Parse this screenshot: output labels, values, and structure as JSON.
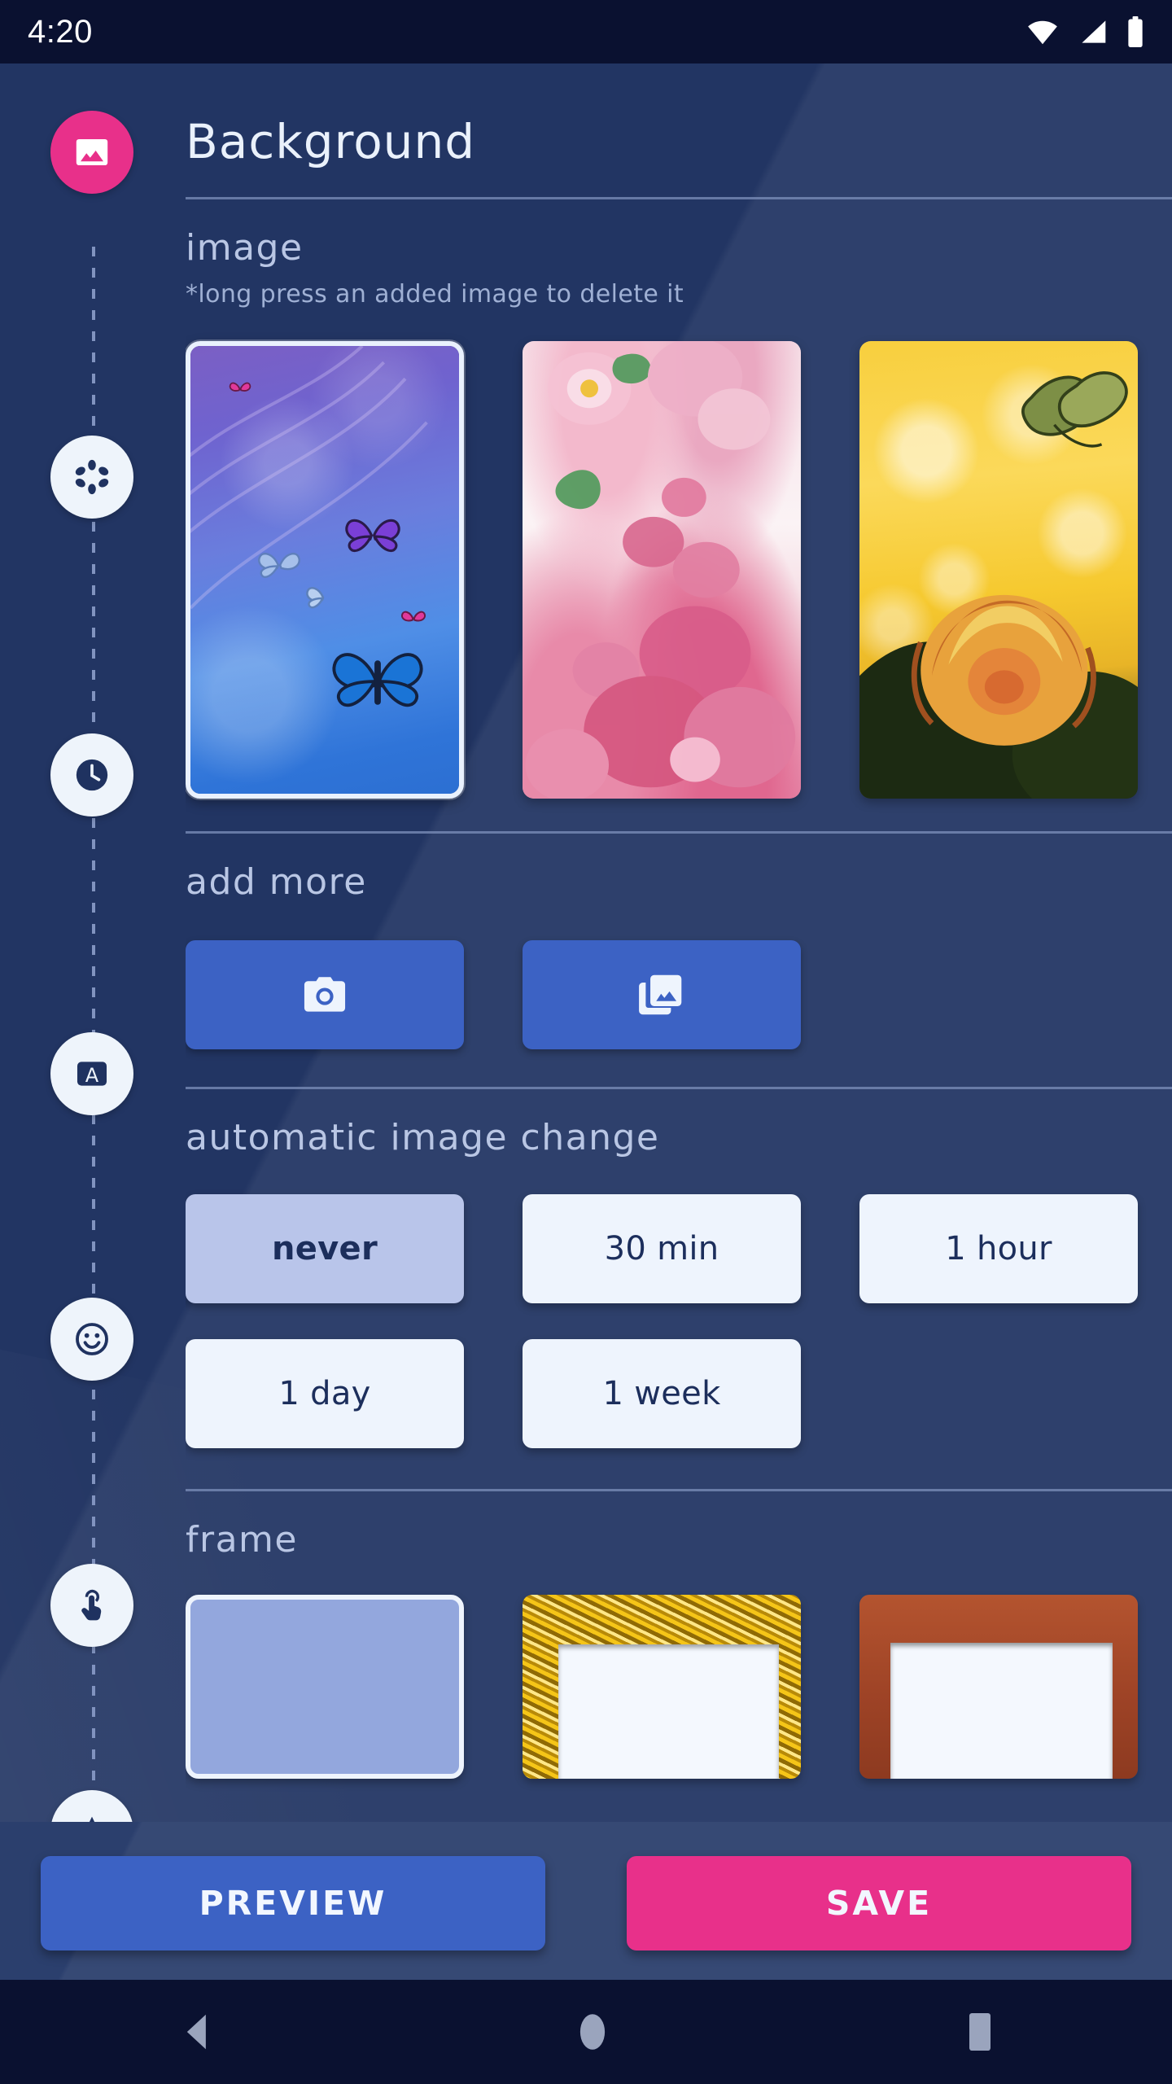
{
  "status_bar": {
    "time": "4:20",
    "icons": [
      "wifi-icon",
      "cellular-signal-icon",
      "battery-icon"
    ]
  },
  "header": {
    "title": "Background",
    "icon": "image-icon",
    "accent_color": "#e8308a"
  },
  "rail": {
    "items": [
      {
        "name": "background-image",
        "icon": "image-icon",
        "active": true
      },
      {
        "name": "style",
        "icon": "flower-icon",
        "active": false
      },
      {
        "name": "clock",
        "icon": "clock-icon",
        "active": false
      },
      {
        "name": "font",
        "icon": "font-a-icon",
        "active": false
      },
      {
        "name": "emoji",
        "icon": "smiley-icon",
        "active": false
      },
      {
        "name": "touch",
        "icon": "touch-pointer-icon",
        "active": false
      },
      {
        "name": "favorites",
        "icon": "star-icon",
        "active": false
      }
    ]
  },
  "sections": {
    "image": {
      "title": "image",
      "note": "*long press an added image to delete it",
      "thumbnails": [
        {
          "name": "butterfly-wallpaper",
          "selected": true
        },
        {
          "name": "pink-flowers-wallpaper",
          "selected": false
        },
        {
          "name": "yellow-rose-wallpaper",
          "selected": false
        }
      ]
    },
    "add_more": {
      "title": "add more",
      "buttons": [
        {
          "name": "camera-button",
          "icon": "camera-icon"
        },
        {
          "name": "gallery-button",
          "icon": "gallery-icon"
        }
      ]
    },
    "automatic_image_change": {
      "title": "automatic image change",
      "options": [
        {
          "label": "never",
          "selected": true
        },
        {
          "label": "30 min",
          "selected": false
        },
        {
          "label": "1 hour",
          "selected": false
        },
        {
          "label": "1 day",
          "selected": false
        },
        {
          "label": "1 week",
          "selected": false
        }
      ]
    },
    "frame": {
      "title": "frame",
      "options": [
        {
          "name": "no-frame",
          "selected": true
        },
        {
          "name": "gold-glitter-frame",
          "selected": false
        },
        {
          "name": "wood-frame",
          "selected": false
        }
      ]
    }
  },
  "actions": {
    "preview_label": "PREVIEW",
    "save_label": "SAVE",
    "preview_color": "#3c62c4",
    "save_color": "#e8308a"
  },
  "navigation_bar": {
    "back": "back-triangle-icon",
    "home": "home-circle-icon",
    "recents": "recents-square-icon"
  },
  "theme": {
    "background": "#223563",
    "card_light": "#eef4fd",
    "chip_selected": "#b9c5ea"
  }
}
